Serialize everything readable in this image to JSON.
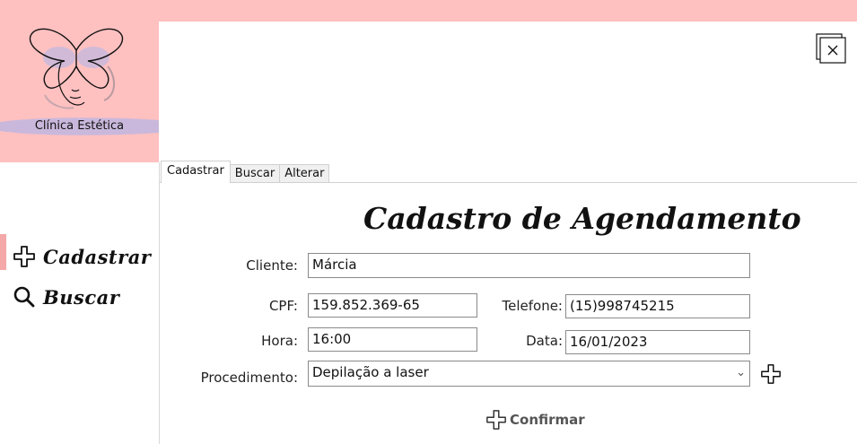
{
  "logo": {
    "text": "Clínica Estética",
    "icon": "butterfly-face-logo"
  },
  "sidebar": {
    "items": [
      {
        "label": "Cadastrar",
        "icon": "plus-icon",
        "active": true
      },
      {
        "label": "Buscar",
        "icon": "search-icon",
        "active": false
      }
    ],
    "accent_color": "#ffc0c0"
  },
  "window": {
    "close_icon": "close-window-icon"
  },
  "tabs": [
    {
      "label": "Cadastrar",
      "active": true
    },
    {
      "label": "Buscar",
      "active": false
    },
    {
      "label": "Alterar",
      "active": false
    }
  ],
  "form": {
    "title": "Cadastro de Agendamento",
    "cliente": {
      "label": "Cliente:",
      "value": "Márcia"
    },
    "cpf": {
      "label": "CPF:",
      "value": "159.852.369-65"
    },
    "telefone": {
      "label": "Telefone:",
      "value": "(15)998745215"
    },
    "hora": {
      "label": "Hora:",
      "value": "16:00"
    },
    "data": {
      "label": "Data:",
      "value": "16/01/2023"
    },
    "procedimento": {
      "label": "Procedimento:",
      "value": "Depilação a laser"
    },
    "confirm_label": "Confirmar"
  }
}
